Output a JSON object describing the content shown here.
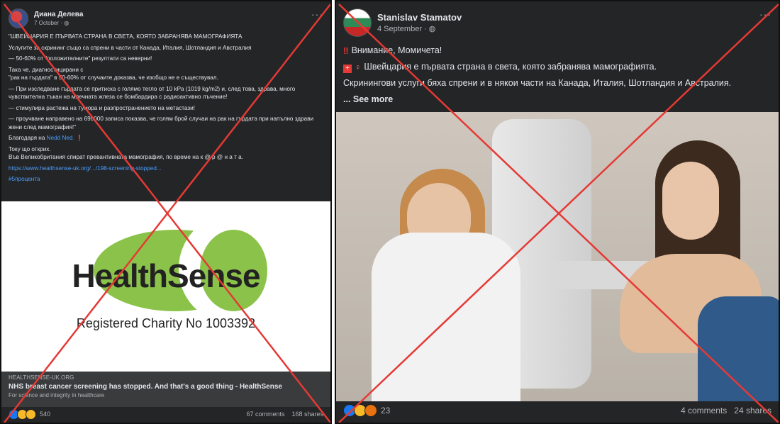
{
  "left_post": {
    "author": "Диана Делева",
    "date": "7 October · ",
    "menu": "···",
    "paragraphs": [
      "\"ШВЕЙЦАРИЯ Е ПЪРВАТА СТРАНА В СВЕТА, КОЯТО ЗАБРАНЯВА МАМОГРАФИЯТА",
      "Услугите за скрининг също са спрени в части от Канада, Италия, Шотландия и Австралия",
      "— 50-60% от \"положителните\" резултати са неверни!",
      "Така че, диагностицирани с\n\"рак на гърдата\" в 50-60% от случаите доказва, че изобщо не е съществувал.",
      "— При изследване гърдата се притиска с голямо тегло от 10 kPa (1019 kg/m2) и, след това, здрава, много чувствителна тъкан на млечната жлеза се бомбардира с радиоактивно лъчение!",
      "— стимулира растежа на тумора и разпространението на метастази!",
      "— проучване направено на 690000 записа показва, че голям брой случаи на рак на гърдата при напълно здрави жени след мамография!\""
    ],
    "thanks_prefix": "Благодаря на ",
    "thanks_name": "Nedd Ned",
    "thanks_suffix": ". ❗",
    "found": "Току що открих.",
    "uk_line": "Във Великобритания спират превантивната мамография, по време на к @ р @ н а т а.",
    "url": "https://www.healthsense-uk.org/.../198-screening-stopped...",
    "hashtag": "#5процента",
    "logo_word": "HealthSense",
    "charity": "Registered Charity No 1003392",
    "domain": "HEALTHSENSE-UK.ORG",
    "link_title": "NHS breast cancer screening has stopped. And that's a good thing - HealthSense",
    "link_sub": "For science and integrity in healthcare",
    "reaction_count": "540",
    "comments": "67 comments",
    "shares": "168 shares"
  },
  "right_post": {
    "author": "Stanislav Stamatov",
    "date": "4 September · ",
    "menu": "···",
    "line1": "Внимание, Момичета!",
    "line2": "Швейцария е първата страна в света, която забранява мамографията.",
    "line3": "Скринингови услуги бяха спрени и в някои части на Канада, Италия, Шотландия и Австралия.",
    "see_more": "... See more",
    "reaction_count": "23",
    "comments": "4 comments",
    "shares": "24 shares"
  },
  "colors": {
    "accent_link": "#4a9eff",
    "cross": "#e53935",
    "healthsense_green": "#8bc34a"
  },
  "icons": {
    "globe": "globe-icon",
    "exclaim": "exclamation-icon",
    "swiss_flag": "swiss-flag-icon",
    "female": "female-symbol-icon"
  }
}
